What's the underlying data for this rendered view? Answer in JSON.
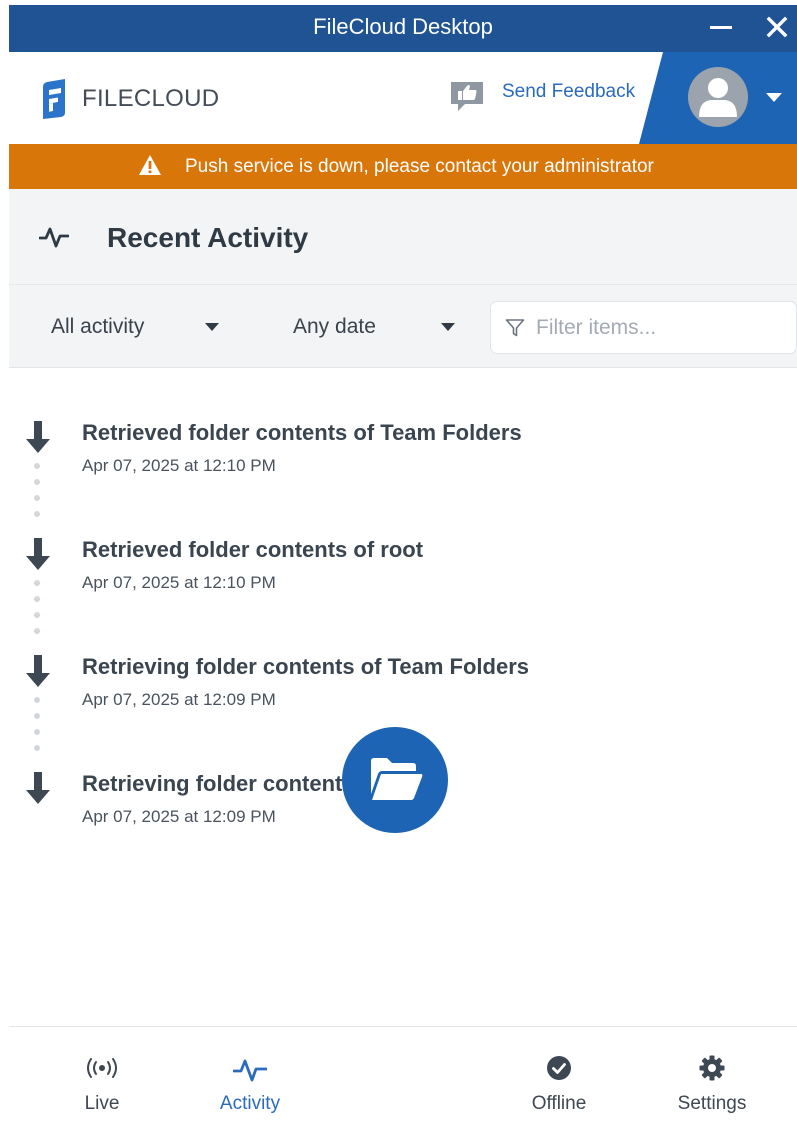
{
  "window": {
    "title": "FileCloud Desktop"
  },
  "header": {
    "logo_text": "FILECLOUD",
    "feedback_label": "Send Feedback"
  },
  "banner": {
    "message": "Push service is down, please contact your administrator"
  },
  "section": {
    "title": "Recent Activity"
  },
  "filters": {
    "activity_type": "All activity",
    "date_range": "Any date",
    "search_placeholder": "Filter items..."
  },
  "activities": [
    {
      "title": "Retrieved folder contents of Team Folders",
      "time": "Apr 07, 2025 at 12:10 PM",
      "icon": "arrow-down-icon"
    },
    {
      "title": "Retrieved folder contents of root",
      "time": "Apr 07, 2025 at 12:10 PM",
      "icon": "arrow-down-icon"
    },
    {
      "title": "Retrieving folder contents of Team Folders",
      "time": "Apr 07, 2025 at 12:09 PM",
      "icon": "arrow-down-icon"
    },
    {
      "title": "Retrieving folder contents of root",
      "time": "Apr 07, 2025 at 12:09 PM",
      "icon": "arrow-down-icon"
    }
  ],
  "nav": {
    "live": "Live",
    "activity": "Activity",
    "offline": "Offline",
    "settings": "Settings",
    "active": "activity"
  },
  "colors": {
    "titlebar": "#1f5394",
    "accent": "#1e64b4",
    "warning": "#d9760a",
    "panel_bg": "#f3f4f5"
  }
}
